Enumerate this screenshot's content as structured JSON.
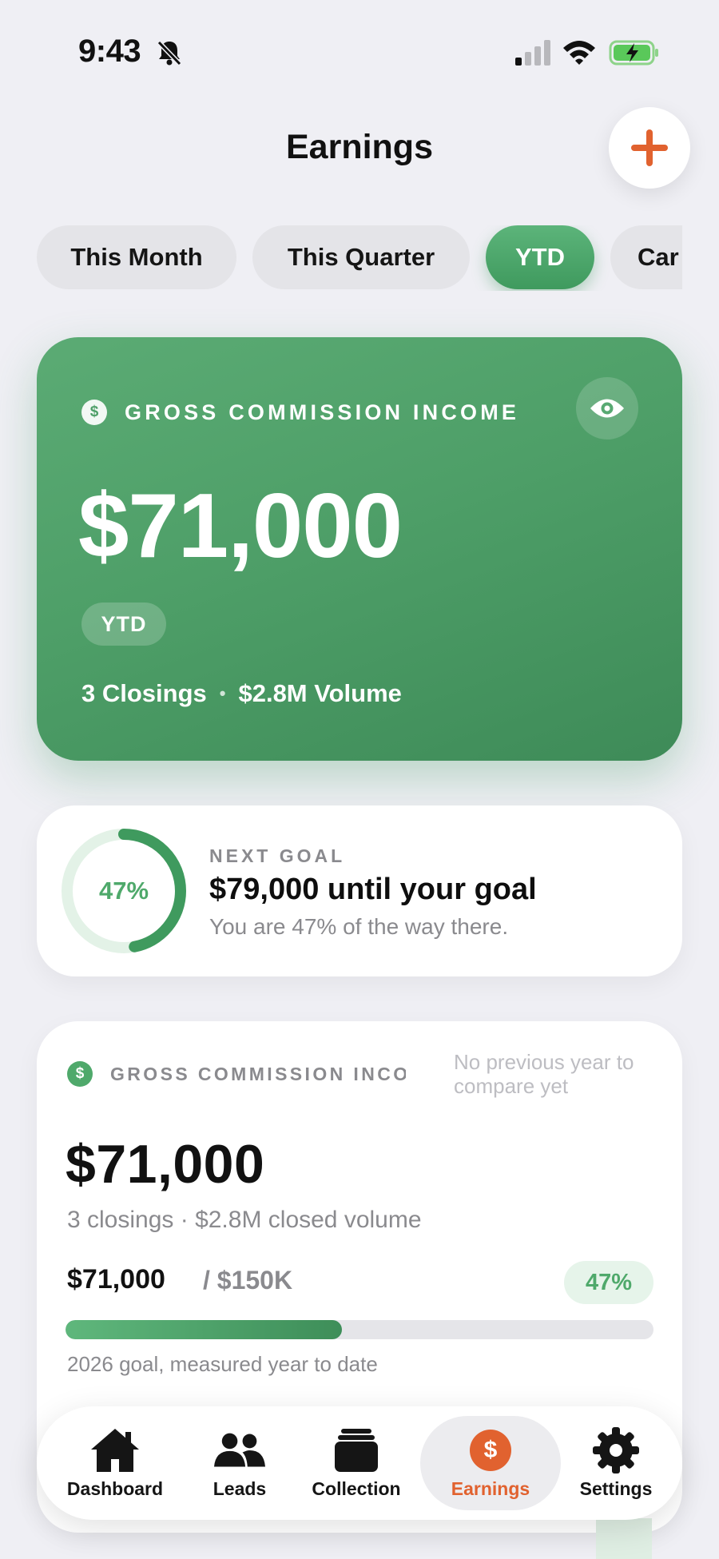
{
  "status_bar": {
    "time": "9:43"
  },
  "header": {
    "title": "Earnings"
  },
  "filters": [
    {
      "label": "This Month",
      "active": false
    },
    {
      "label": "This Quarter",
      "active": false
    },
    {
      "label": "YTD",
      "active": true
    },
    {
      "label": "Car",
      "active": false
    }
  ],
  "hero": {
    "dollar_icon": "$",
    "label": "GROSS COMMISSION INCOME",
    "amount": "$71,000",
    "badge": "YTD",
    "closings": "3 Closings",
    "separator": "•",
    "volume": "$2.8M Volume"
  },
  "goal": {
    "percent_label": "47%",
    "percent": 0.47,
    "eyebrow": "NEXT GOAL",
    "title": "$79,000 until your goal",
    "subtitle": "You are 47% of the way there."
  },
  "summary": {
    "dollar_icon": "$",
    "label": "GROSS COMMISSION INCO…",
    "compare_note": "No previous year to compare yet",
    "amount": "$71,000",
    "meta": "3 closings · $2.8M closed volume",
    "progress_value": "$71,000",
    "progress_target": "/ $150K",
    "progress_pct_label": "47%",
    "progress_fraction": 0.47,
    "caption": "2026 goal, measured year to date"
  },
  "tabbar": {
    "items": [
      {
        "label": "Dashboard",
        "icon": "house-icon",
        "active": false
      },
      {
        "label": "Leads",
        "icon": "people-icon",
        "active": false
      },
      {
        "label": "Collection",
        "icon": "stack-icon",
        "active": false
      },
      {
        "label": "Earnings",
        "icon": "dollar-circle-icon",
        "active": true
      },
      {
        "label": "Settings",
        "icon": "gear-icon",
        "active": false
      }
    ],
    "earnings_symbol": "$"
  },
  "colors": {
    "accent_green": "#4fa96b",
    "accent_orange": "#e1622f",
    "background": "#efeff4"
  }
}
